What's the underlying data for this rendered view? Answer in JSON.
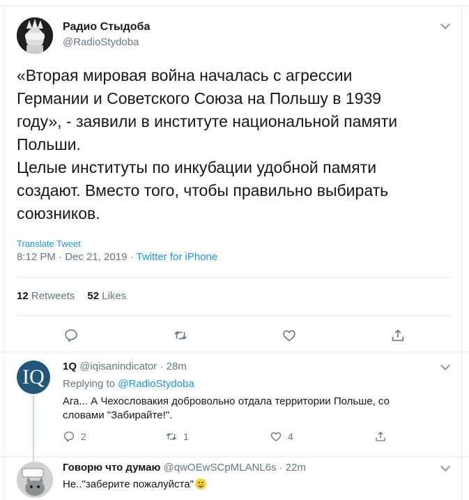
{
  "main_tweet": {
    "author_name": "Радио Стыдоба",
    "author_handle": "@RadioStydoba",
    "text": "«Вторая мировая война началась с агрессии\nГермании и Советского Союза на Польшу в 1939\nгоду», - заявили в институте национальной памяти\nПольши.\nЦелые институты по инкубации удобной памяти\nсоздают. Вместо того, чтобы правильно выбирать\nсоюзников.",
    "translate_label": "Translate Tweet",
    "timestamp": "8:12 PM · Dec 21, 2019 · ",
    "source": "Twitter for iPhone",
    "retweets_count": "12",
    "retweets_label": "Retweets",
    "likes_count": "52",
    "likes_label": "Likes",
    "actions": [
      "reply-icon",
      "retweet-icon",
      "like-icon",
      "share-icon"
    ]
  },
  "replies": [
    {
      "avatar_text": "IQ",
      "author_name": "1Q",
      "author_handle": "@iqisanindicator",
      "time": " · 28m",
      "replying_prefix": "Replying to ",
      "replying_to": "@RadioStydoba",
      "text": "Ага... А Чехословакия добровольно отдала территории Польше, со словами \"Забирайте!\".",
      "reply_count": "2",
      "retweet_count": "1",
      "like_count": "4"
    },
    {
      "author_name": "Говорю что думаю",
      "author_handle": "@qwOEwSCpMLANL6s",
      "time": " · 22m",
      "text": "Не..\"заберите пожалуйста\"",
      "emoji": "grinning-face-icon"
    }
  ],
  "colors": {
    "accent": "#1b95e0",
    "secondary_text": "#657786",
    "border": "#e6ecf0",
    "avatar_iq_bg": "#22577a"
  }
}
